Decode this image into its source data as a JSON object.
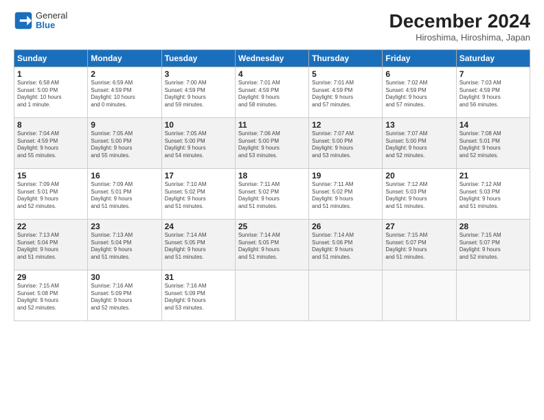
{
  "logo": {
    "general": "General",
    "blue": "Blue"
  },
  "header": {
    "month": "December 2024",
    "location": "Hiroshima, Hiroshima, Japan"
  },
  "weekdays": [
    "Sunday",
    "Monday",
    "Tuesday",
    "Wednesday",
    "Thursday",
    "Friday",
    "Saturday"
  ],
  "weeks": [
    [
      {
        "day": "1",
        "lines": [
          "Sunrise: 6:58 AM",
          "Sunset: 5:00 PM",
          "Daylight: 10 hours",
          "and 1 minute."
        ]
      },
      {
        "day": "2",
        "lines": [
          "Sunrise: 6:59 AM",
          "Sunset: 4:59 PM",
          "Daylight: 10 hours",
          "and 0 minutes."
        ]
      },
      {
        "day": "3",
        "lines": [
          "Sunrise: 7:00 AM",
          "Sunset: 4:59 PM",
          "Daylight: 9 hours",
          "and 59 minutes."
        ]
      },
      {
        "day": "4",
        "lines": [
          "Sunrise: 7:01 AM",
          "Sunset: 4:59 PM",
          "Daylight: 9 hours",
          "and 58 minutes."
        ]
      },
      {
        "day": "5",
        "lines": [
          "Sunrise: 7:01 AM",
          "Sunset: 4:59 PM",
          "Daylight: 9 hours",
          "and 57 minutes."
        ]
      },
      {
        "day": "6",
        "lines": [
          "Sunrise: 7:02 AM",
          "Sunset: 4:59 PM",
          "Daylight: 9 hours",
          "and 57 minutes."
        ]
      },
      {
        "day": "7",
        "lines": [
          "Sunrise: 7:03 AM",
          "Sunset: 4:59 PM",
          "Daylight: 9 hours",
          "and 56 minutes."
        ]
      }
    ],
    [
      {
        "day": "8",
        "lines": [
          "Sunrise: 7:04 AM",
          "Sunset: 4:59 PM",
          "Daylight: 9 hours",
          "and 55 minutes."
        ]
      },
      {
        "day": "9",
        "lines": [
          "Sunrise: 7:05 AM",
          "Sunset: 5:00 PM",
          "Daylight: 9 hours",
          "and 55 minutes."
        ]
      },
      {
        "day": "10",
        "lines": [
          "Sunrise: 7:05 AM",
          "Sunset: 5:00 PM",
          "Daylight: 9 hours",
          "and 54 minutes."
        ]
      },
      {
        "day": "11",
        "lines": [
          "Sunrise: 7:06 AM",
          "Sunset: 5:00 PM",
          "Daylight: 9 hours",
          "and 53 minutes."
        ]
      },
      {
        "day": "12",
        "lines": [
          "Sunrise: 7:07 AM",
          "Sunset: 5:00 PM",
          "Daylight: 9 hours",
          "and 53 minutes."
        ]
      },
      {
        "day": "13",
        "lines": [
          "Sunrise: 7:07 AM",
          "Sunset: 5:00 PM",
          "Daylight: 9 hours",
          "and 52 minutes."
        ]
      },
      {
        "day": "14",
        "lines": [
          "Sunrise: 7:08 AM",
          "Sunset: 5:01 PM",
          "Daylight: 9 hours",
          "and 52 minutes."
        ]
      }
    ],
    [
      {
        "day": "15",
        "lines": [
          "Sunrise: 7:09 AM",
          "Sunset: 5:01 PM",
          "Daylight: 9 hours",
          "and 52 minutes."
        ]
      },
      {
        "day": "16",
        "lines": [
          "Sunrise: 7:09 AM",
          "Sunset: 5:01 PM",
          "Daylight: 9 hours",
          "and 51 minutes."
        ]
      },
      {
        "day": "17",
        "lines": [
          "Sunrise: 7:10 AM",
          "Sunset: 5:02 PM",
          "Daylight: 9 hours",
          "and 51 minutes."
        ]
      },
      {
        "day": "18",
        "lines": [
          "Sunrise: 7:11 AM",
          "Sunset: 5:02 PM",
          "Daylight: 9 hours",
          "and 51 minutes."
        ]
      },
      {
        "day": "19",
        "lines": [
          "Sunrise: 7:11 AM",
          "Sunset: 5:02 PM",
          "Daylight: 9 hours",
          "and 51 minutes."
        ]
      },
      {
        "day": "20",
        "lines": [
          "Sunrise: 7:12 AM",
          "Sunset: 5:03 PM",
          "Daylight: 9 hours",
          "and 51 minutes."
        ]
      },
      {
        "day": "21",
        "lines": [
          "Sunrise: 7:12 AM",
          "Sunset: 5:03 PM",
          "Daylight: 9 hours",
          "and 51 minutes."
        ]
      }
    ],
    [
      {
        "day": "22",
        "lines": [
          "Sunrise: 7:13 AM",
          "Sunset: 5:04 PM",
          "Daylight: 9 hours",
          "and 51 minutes."
        ]
      },
      {
        "day": "23",
        "lines": [
          "Sunrise: 7:13 AM",
          "Sunset: 5:04 PM",
          "Daylight: 9 hours",
          "and 51 minutes."
        ]
      },
      {
        "day": "24",
        "lines": [
          "Sunrise: 7:14 AM",
          "Sunset: 5:05 PM",
          "Daylight: 9 hours",
          "and 51 minutes."
        ]
      },
      {
        "day": "25",
        "lines": [
          "Sunrise: 7:14 AM",
          "Sunset: 5:05 PM",
          "Daylight: 9 hours",
          "and 51 minutes."
        ]
      },
      {
        "day": "26",
        "lines": [
          "Sunrise: 7:14 AM",
          "Sunset: 5:06 PM",
          "Daylight: 9 hours",
          "and 51 minutes."
        ]
      },
      {
        "day": "27",
        "lines": [
          "Sunrise: 7:15 AM",
          "Sunset: 5:07 PM",
          "Daylight: 9 hours",
          "and 51 minutes."
        ]
      },
      {
        "day": "28",
        "lines": [
          "Sunrise: 7:15 AM",
          "Sunset: 5:07 PM",
          "Daylight: 9 hours",
          "and 52 minutes."
        ]
      }
    ],
    [
      {
        "day": "29",
        "lines": [
          "Sunrise: 7:15 AM",
          "Sunset: 5:08 PM",
          "Daylight: 9 hours",
          "and 52 minutes."
        ]
      },
      {
        "day": "30",
        "lines": [
          "Sunrise: 7:16 AM",
          "Sunset: 5:09 PM",
          "Daylight: 9 hours",
          "and 52 minutes."
        ]
      },
      {
        "day": "31",
        "lines": [
          "Sunrise: 7:16 AM",
          "Sunset: 5:09 PM",
          "Daylight: 9 hours",
          "and 53 minutes."
        ]
      },
      null,
      null,
      null,
      null
    ]
  ]
}
